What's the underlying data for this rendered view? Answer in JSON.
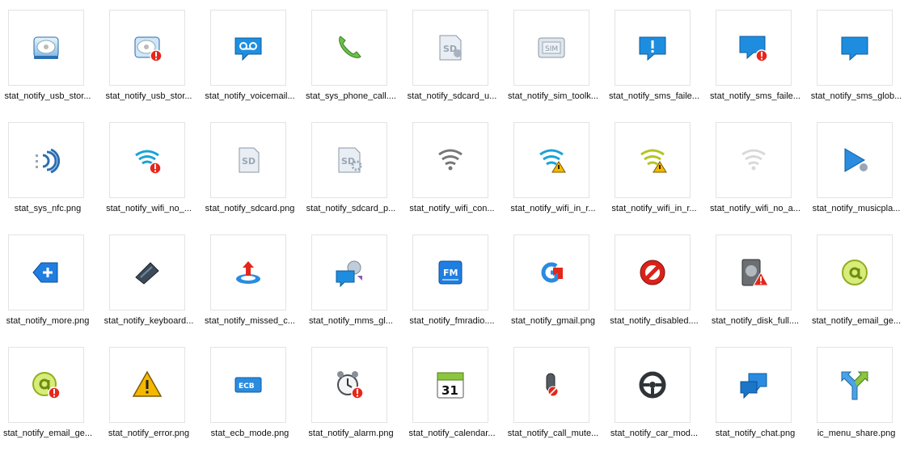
{
  "files": [
    {
      "name": "stat_notify_usb_stor...",
      "icon": "usb-storage-icon"
    },
    {
      "name": "stat_notify_usb_stor...",
      "icon": "usb-storage-error-icon"
    },
    {
      "name": "stat_notify_voicemail...",
      "icon": "voicemail-icon"
    },
    {
      "name": "stat_sys_phone_call....",
      "icon": "phone-call-icon"
    },
    {
      "name": "stat_notify_sdcard_u...",
      "icon": "sdcard-usb-icon"
    },
    {
      "name": "stat_notify_sim_toolk...",
      "icon": "sim-toolkit-icon"
    },
    {
      "name": "stat_notify_sms_faile...",
      "icon": "sms-failed-icon"
    },
    {
      "name": "stat_notify_sms_faile...",
      "icon": "sms-failed-error-icon"
    },
    {
      "name": "stat_notify_sms_glob...",
      "icon": "sms-global-icon"
    },
    {
      "name": "stat_sys_nfc.png",
      "icon": "nfc-icon"
    },
    {
      "name": "stat_notify_wifi_no_...",
      "icon": "wifi-no-error-icon"
    },
    {
      "name": "stat_notify_sdcard.png",
      "icon": "sdcard-icon"
    },
    {
      "name": "stat_notify_sdcard_p...",
      "icon": "sdcard-prepare-icon"
    },
    {
      "name": "stat_notify_wifi_con...",
      "icon": "wifi-connected-icon"
    },
    {
      "name": "stat_notify_wifi_in_r...",
      "icon": "wifi-in-range-warning-icon"
    },
    {
      "name": "stat_notify_wifi_in_r...",
      "icon": "wifi-in-range-yellow-icon"
    },
    {
      "name": "stat_notify_wifi_no_a...",
      "icon": "wifi-no-access-icon"
    },
    {
      "name": "stat_notify_musicpla...",
      "icon": "music-player-icon"
    },
    {
      "name": "stat_notify_more.png",
      "icon": "more-icon"
    },
    {
      "name": "stat_notify_keyboard...",
      "icon": "keyboard-icon"
    },
    {
      "name": "stat_notify_missed_c...",
      "icon": "missed-call-icon"
    },
    {
      "name": "stat_notify_mms_gl...",
      "icon": "mms-global-icon"
    },
    {
      "name": "stat_notify_fmradio....",
      "icon": "fm-radio-icon"
    },
    {
      "name": "stat_notify_gmail.png",
      "icon": "gmail-icon"
    },
    {
      "name": "stat_notify_disabled....",
      "icon": "disabled-icon"
    },
    {
      "name": "stat_notify_disk_full....",
      "icon": "disk-full-icon"
    },
    {
      "name": "stat_notify_email_ge...",
      "icon": "email-generic-icon"
    },
    {
      "name": "stat_notify_email_ge...",
      "icon": "email-error-icon"
    },
    {
      "name": "stat_notify_error.png",
      "icon": "error-warning-icon"
    },
    {
      "name": "stat_ecb_mode.png",
      "icon": "ecb-mode-icon"
    },
    {
      "name": "stat_notify_alarm.png",
      "icon": "alarm-icon"
    },
    {
      "name": "stat_notify_calendar...",
      "icon": "calendar-icon",
      "text": "31"
    },
    {
      "name": "stat_notify_call_mute...",
      "icon": "call-mute-icon"
    },
    {
      "name": "stat_notify_car_mod...",
      "icon": "car-mode-icon"
    },
    {
      "name": "stat_notify_chat.png",
      "icon": "chat-icon"
    },
    {
      "name": "ic_menu_share.png",
      "icon": "share-icon"
    }
  ]
}
